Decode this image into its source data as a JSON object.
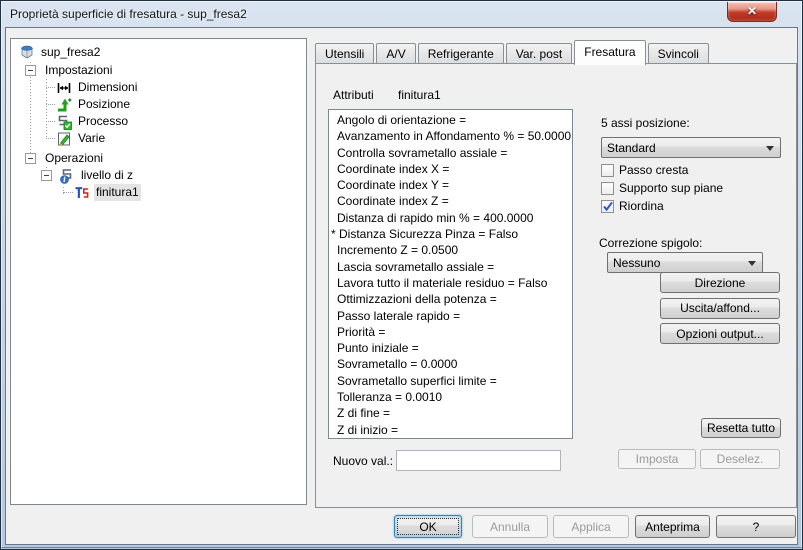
{
  "window": {
    "title": "Proprietà superficie di fresatura - sup_fresa2",
    "close_glyph": "✕"
  },
  "colors": {
    "close_button_red": "#c03b28",
    "checkmark_blue": "#3156c4",
    "default_button_border": "#3c7fb1",
    "dialog_background": "#f0f0f0"
  },
  "tree": {
    "rows": [
      {
        "label": "sup_fresa2",
        "icon": "cube-icon",
        "depth": 0
      },
      {
        "label": "Impostazioni",
        "depth": 1,
        "expander": true
      },
      {
        "label": "Dimensioni",
        "icon": "dimensions-icon",
        "depth": 2
      },
      {
        "label": "Posizione",
        "icon": "position-icon",
        "depth": 2
      },
      {
        "label": "Processo",
        "icon": "process-icon",
        "depth": 2
      },
      {
        "label": "Varie",
        "icon": "varie-icon",
        "depth": 2
      },
      {
        "label": "Operazioni",
        "depth": 1,
        "expander": true
      },
      {
        "label": "livello di z",
        "icon": "levels-icon",
        "depth": 2,
        "expander": true
      },
      {
        "label": "finitura1",
        "icon": "finish-icon",
        "depth": 3,
        "selected": true
      }
    ]
  },
  "tabs": {
    "items": [
      "Utensili",
      "A/V",
      "Refrigerante",
      "Var. post",
      "Fresatura",
      "Svincoli"
    ],
    "active": "Fresatura"
  },
  "attributes": {
    "label": "Attributi",
    "operation": "finitura1",
    "items": [
      "Angolo di orientazione =",
      "Avanzamento in Affondamento % = 50.0000",
      "Controlla sovrametallo assiale =",
      "Coordinate index X =",
      "Coordinate index Y =",
      "Coordinate index Z =",
      "Distanza di rapido min % = 400.0000",
      "* Distanza Sicurezza Pinza = Falso",
      "Incremento Z = 0.0500",
      "Lascia sovrametallo assiale =",
      "Lavora tutto il materiale residuo = Falso",
      "Ottimizzazioni della potenza =",
      "Passo laterale rapido =",
      "Priorità =",
      "Punto iniziale =",
      "Sovrametallo = 0.0000",
      "Sovrametallo superfici limite =",
      "Tolleranza = 0.0010",
      "Z di fine =",
      "Z di inizio ="
    ]
  },
  "controls": {
    "axis_label": "5 assi posizione:",
    "axis_value": "Standard",
    "checkboxes": [
      {
        "label": "Passo cresta",
        "checked": false
      },
      {
        "label": "Supporto sup piane",
        "checked": false
      },
      {
        "label": "Riordina",
        "checked": true
      }
    ],
    "corner_label": "Correzione spigolo:",
    "corner_value": "Nessuno",
    "action_buttons": [
      {
        "label": "Direzione"
      },
      {
        "label": "Uscita/affond..."
      },
      {
        "label": "Opzioni output..."
      }
    ],
    "reset_label": "Resetta tutto",
    "new_value_label": "Nuovo val.:",
    "new_value": "",
    "set_label": "Imposta",
    "deselect_label": "Deselez."
  },
  "footer": {
    "buttons": [
      {
        "label": "OK",
        "state": "default"
      },
      {
        "label": "Annulla",
        "state": "disabled"
      },
      {
        "label": "Applica",
        "state": "disabled"
      },
      {
        "label": "Anteprima",
        "state": "normal"
      },
      {
        "label": "?",
        "state": "normal"
      }
    ]
  }
}
